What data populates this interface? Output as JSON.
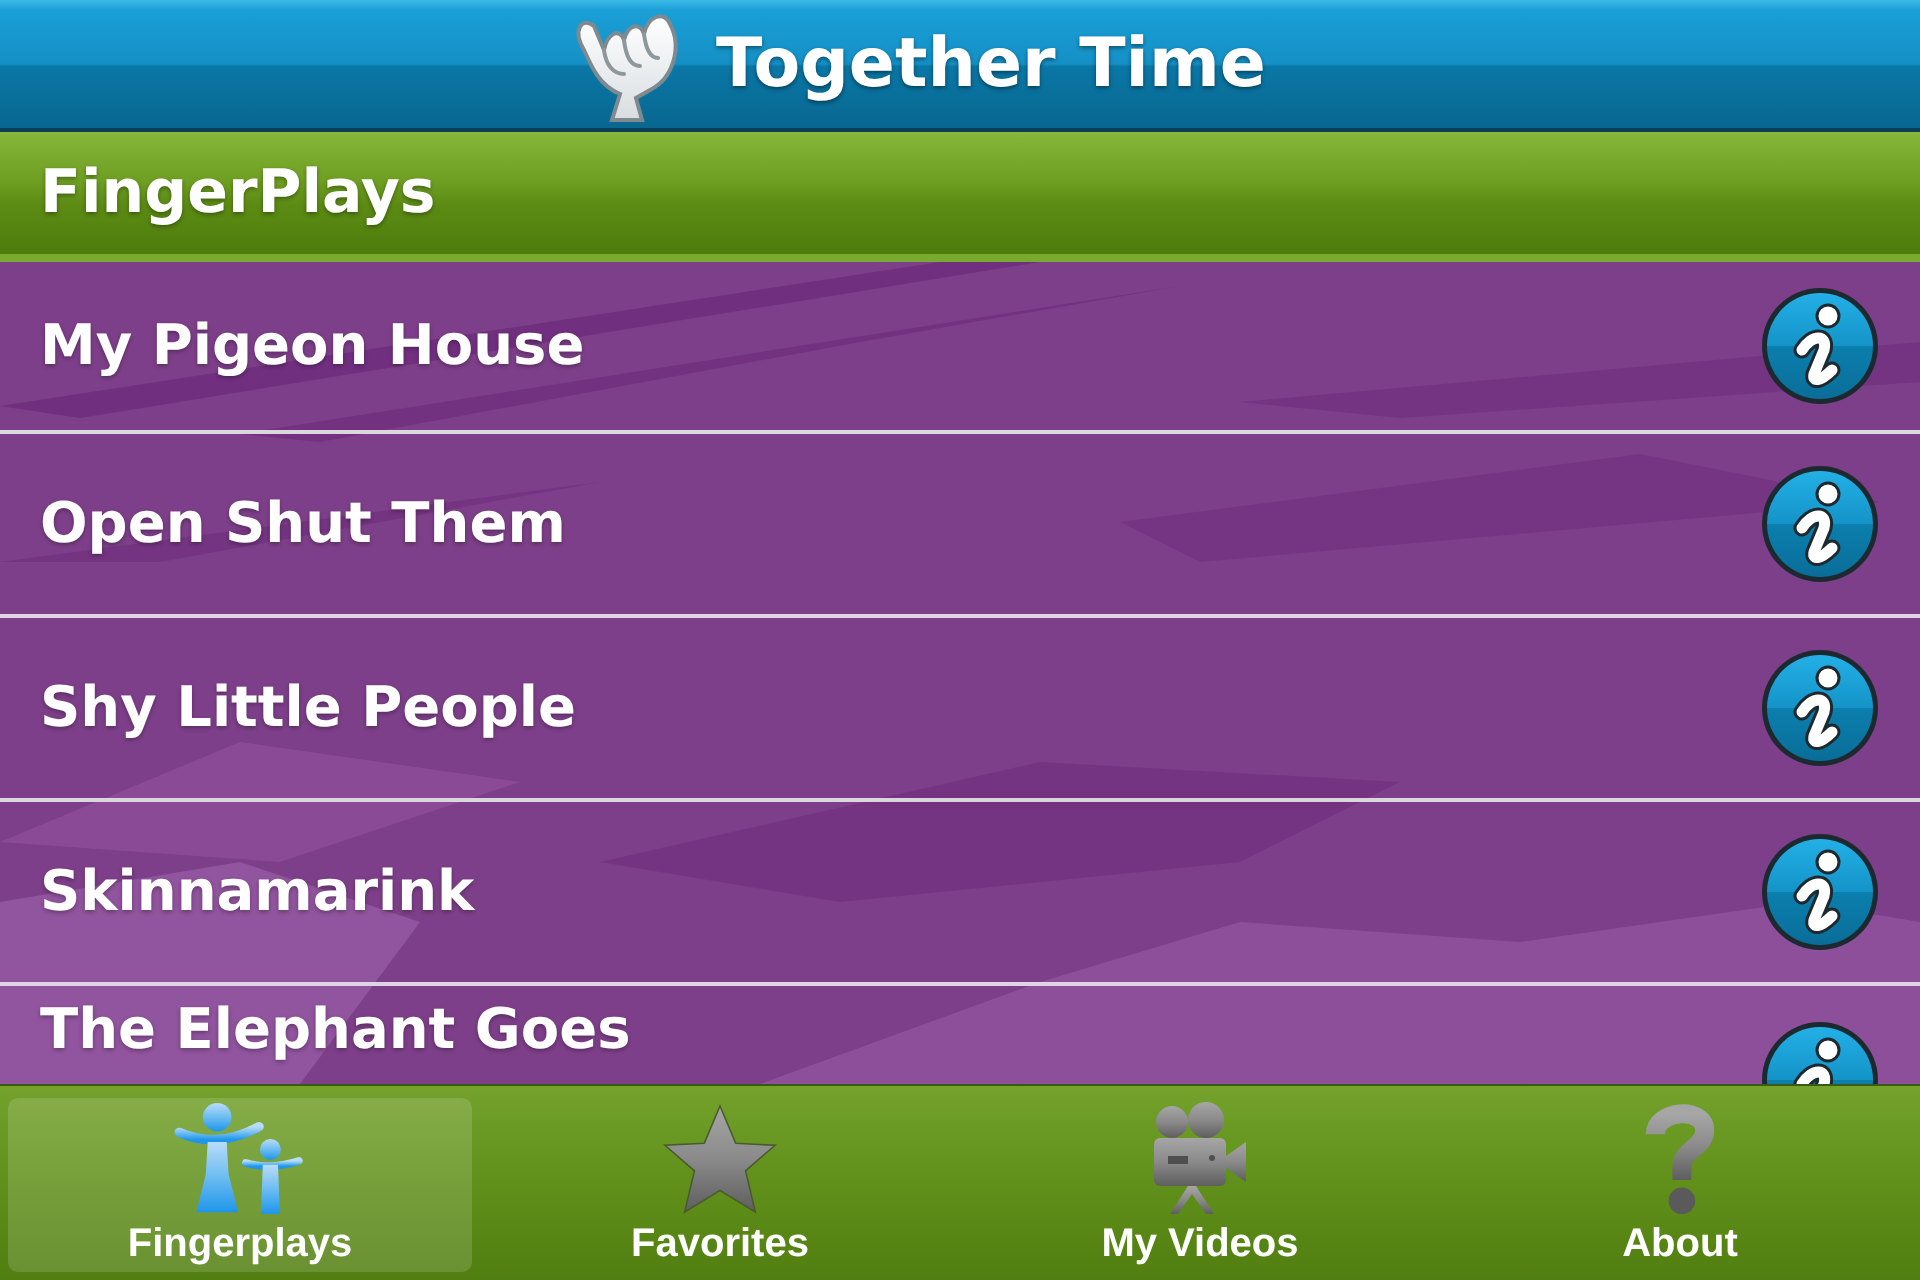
{
  "header": {
    "title": "Together Time"
  },
  "section": {
    "title": "FingerPlays"
  },
  "items": [
    {
      "title": "My Pigeon House"
    },
    {
      "title": "Open Shut Them"
    },
    {
      "title": "Shy Little People"
    },
    {
      "title": "Skinnamarink"
    },
    {
      "title": "The Elephant Goes"
    }
  ],
  "tab_bar": {
    "tabs": [
      {
        "label": "Fingerplays",
        "selected": true
      },
      {
        "label": "Favorites",
        "selected": false
      },
      {
        "label": "My Videos",
        "selected": false
      },
      {
        "label": "About",
        "selected": false
      }
    ]
  }
}
